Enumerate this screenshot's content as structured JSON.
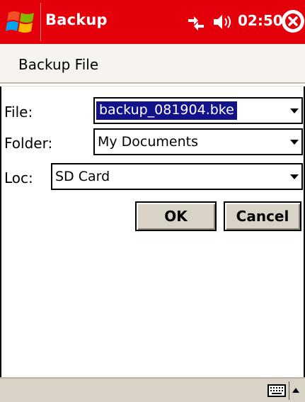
{
  "titlebar": {
    "app_title": "Backup",
    "clock": "02:50",
    "start_icon": "windows-flag-icon",
    "connectivity_icon": "connectivity-icon",
    "volume_icon": "speaker-icon",
    "close_icon": "close-icon"
  },
  "header": {
    "title": "Backup File"
  },
  "form": {
    "file_label": "File:",
    "file_value": "backup_081904.bke",
    "folder_label": "Folder:",
    "folder_value": "My Documents",
    "loc_label": "Loc:",
    "loc_value": "SD Card"
  },
  "buttons": {
    "ok": "OK",
    "cancel": "Cancel"
  },
  "colors": {
    "titlebar": "#e3000b",
    "selection": "#12128a",
    "button_face": "#d9d2c6"
  },
  "bottombar": {
    "keyboard_icon": "keyboard-icon",
    "sip_arrow_icon": "up-arrow-icon"
  }
}
